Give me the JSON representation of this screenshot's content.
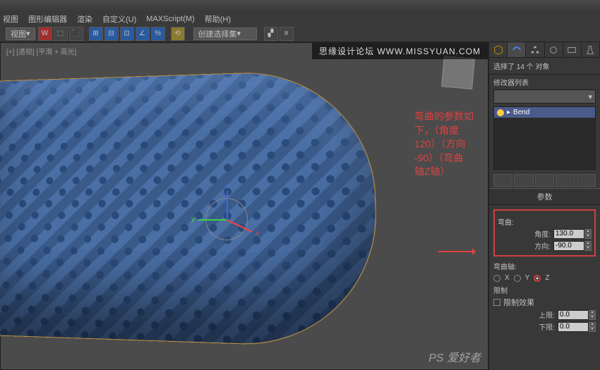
{
  "menu": {
    "items": [
      "视图",
      "图形编辑器",
      "渲染",
      "自定义(U)",
      "MAXScript(M)",
      "帮助(H)"
    ]
  },
  "toolbar": {
    "dropdown1": "视图",
    "dropdown2": "创建选择集"
  },
  "viewport": {
    "label": "[+] [透视] [平滑 + 高光]"
  },
  "watermark": {
    "top": "思缘设计论坛  WWW.MISSYUAN.COM",
    "bottom": "PS 爱好者"
  },
  "annotation": {
    "line1": "弯曲的参数如",
    "line2": "下，（角度",
    "line3": "120）（方向",
    "line4": "-90）（弯曲",
    "line5": "轴Z轴）"
  },
  "panel": {
    "selection_info": "选择了 14 个 对象",
    "modifier_list_label": "修改器列表",
    "modifier_item": "Bend",
    "rollout_title": "参数",
    "bend_section": "弯曲:",
    "angle_label": "角度:",
    "angle_value": "130.0",
    "direction_label": "方向:",
    "direction_value": "-90.0",
    "axis_section": "弯曲轴:",
    "axis_x": "X",
    "axis_y": "Y",
    "axis_z": "Z",
    "limit_section": "限制",
    "limit_effect": "限制效果",
    "upper_label": "上限:",
    "upper_value": "0.0",
    "lower_label": "下限:",
    "lower_value": "0.0"
  }
}
